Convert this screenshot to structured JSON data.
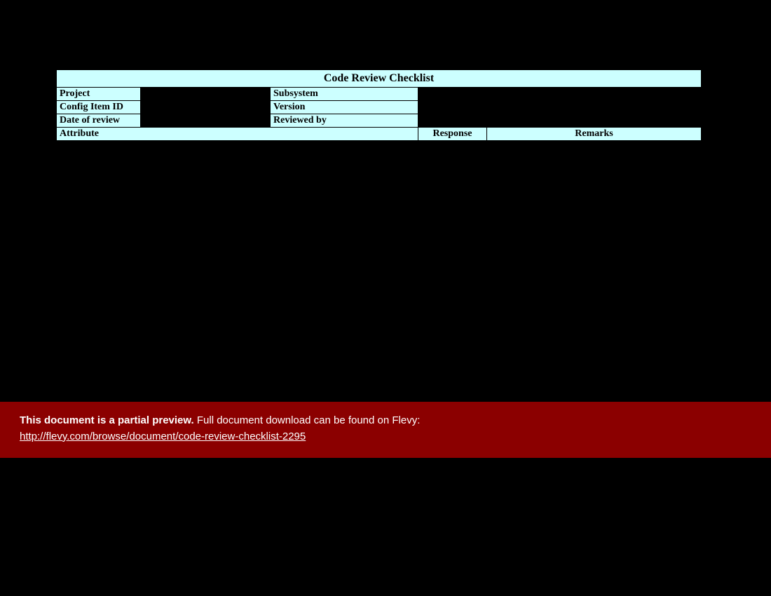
{
  "title": "Code Review Checklist",
  "labels": {
    "project": "Project",
    "subsystem": "Subsystem",
    "config_item_id": "Config Item ID",
    "version": "Version",
    "date_of_review": "Date of review",
    "reviewed_by": "Reviewed by",
    "attribute": "Attribute",
    "response": "Response",
    "remarks": "Remarks"
  },
  "values": {
    "project": "",
    "subsystem": "",
    "config_item_id": "",
    "version": "",
    "date_of_review": "",
    "reviewed_by": ""
  },
  "banner": {
    "bold": "This document is a partial preview.",
    "rest": "  Full document download can be found on Flevy:",
    "link_text": "http://flevy.com/browse/document/code-review-checklist-2295",
    "link_href": "http://flevy.com/browse/document/code-review-checklist-2295"
  }
}
